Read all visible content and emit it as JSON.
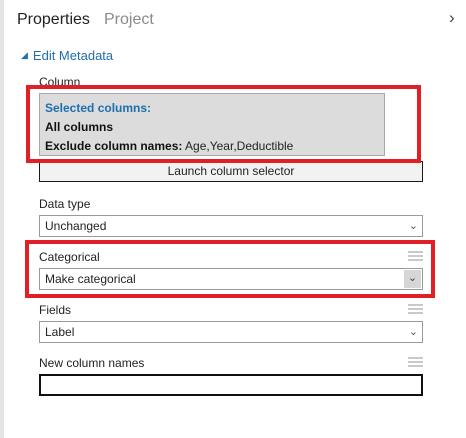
{
  "tabs": {
    "properties": "Properties",
    "project": "Project"
  },
  "panel": {
    "collapse_icon": "›"
  },
  "section": {
    "title": "Edit Metadata",
    "expand_icon": "◢"
  },
  "column": {
    "label": "Column",
    "selected_header": "Selected columns:",
    "all_columns": "All columns",
    "exclude_label": "Exclude column names:",
    "exclude_value": " Age,Year,Deductible",
    "launch_button": "Launch column selector"
  },
  "data_type": {
    "label": "Data type",
    "value": "Unchanged"
  },
  "categorical": {
    "label": "Categorical",
    "value": "Make categorical"
  },
  "fields": {
    "label": "Fields",
    "value": "Label"
  },
  "new_names": {
    "label": "New column names",
    "value": ""
  },
  "highlight_color": "#e11f26",
  "accent_color": "#1d6fae"
}
